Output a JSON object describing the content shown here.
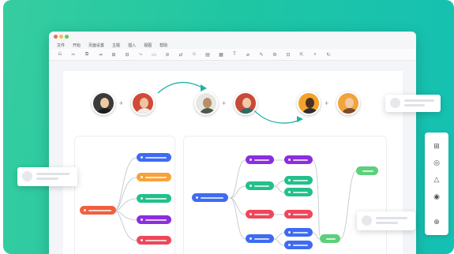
{
  "window": {
    "menu": [
      "文件",
      "开始",
      "页面设置",
      "主题",
      "插入",
      "视图",
      "帮助"
    ],
    "toolbar": [
      "⎌",
      "✂",
      "⧉",
      "⇥",
      "⊞",
      "⊟",
      "⤷",
      "▭",
      "⊘",
      "⇄",
      "☺",
      "▤",
      "▦",
      "T",
      "⌀",
      "✎",
      "⚙",
      "⊡",
      "⇱",
      "⌕",
      "↻"
    ]
  },
  "platforms": [
    {
      "icon": "windows-icon",
      "glyph": "⊞"
    },
    {
      "icon": "macos-icon",
      "glyph": "◎"
    },
    {
      "icon": "linux-icon",
      "glyph": "△"
    },
    {
      "icon": "chrome-icon",
      "glyph": "◉"
    },
    {
      "icon": "apple-icon",
      "glyph": ""
    },
    {
      "icon": "android-icon",
      "glyph": "⊕"
    }
  ],
  "colors": {
    "blue": "#3e6bf2",
    "orange": "#f7a23a",
    "green": "#22c08a",
    "purple": "#8a2ee0",
    "red": "#f0465a",
    "teal": "#22b2a6",
    "lightgreen": "#5cd07a",
    "root": "#f0603e"
  }
}
